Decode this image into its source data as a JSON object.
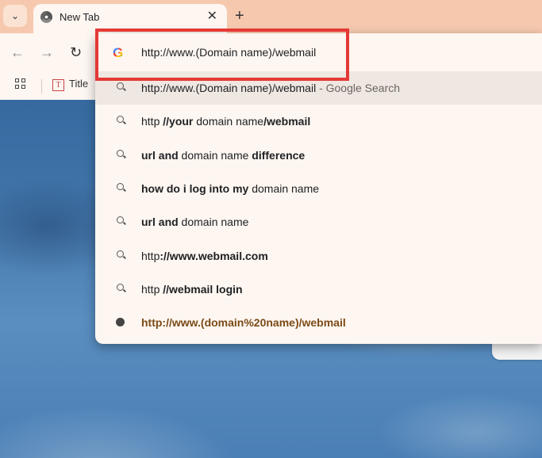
{
  "tabs": [
    {
      "title": "New Tab",
      "close_glyph": "✕"
    }
  ],
  "tab_search_glyph": "⌄",
  "new_tab_glyph": "+",
  "toolbar": {
    "back_glyph": "←",
    "forward_glyph": "→",
    "reload_glyph": "↻"
  },
  "bookmarks": {
    "items": [
      {
        "label": "Title",
        "favicon_letter": "T"
      }
    ]
  },
  "omnibox": {
    "value": "http://www.(Domain name)/webmail",
    "suggestions": [
      {
        "icon": "search-icon",
        "parts": [
          {
            "t": "http://www.(Domain name)/webmail"
          },
          {
            "t": " - Google Search",
            "gray": true
          }
        ]
      },
      {
        "icon": "search-icon",
        "parts": [
          {
            "t": "http "
          },
          {
            "t": "//your",
            "b": true
          },
          {
            "t": " domain name"
          },
          {
            "t": "/webmail",
            "b": true
          }
        ]
      },
      {
        "icon": "search-icon",
        "parts": [
          {
            "t": "url and",
            "b": true
          },
          {
            "t": " domain name "
          },
          {
            "t": "difference",
            "b": true
          }
        ]
      },
      {
        "icon": "search-icon",
        "parts": [
          {
            "t": "how do i log into my",
            "b": true
          },
          {
            "t": " domain name"
          }
        ]
      },
      {
        "icon": "search-icon",
        "parts": [
          {
            "t": "url and",
            "b": true
          },
          {
            "t": " domain name"
          }
        ]
      },
      {
        "icon": "search-icon",
        "parts": [
          {
            "t": "http"
          },
          {
            "t": "://www.webmail",
            "b": true
          },
          {
            "t": ".com",
            "b": true
          }
        ]
      },
      {
        "icon": "search-icon",
        "parts": [
          {
            "t": "http "
          },
          {
            "t": "//webmail",
            "b": true
          },
          {
            "t": " login",
            "b": true
          }
        ]
      },
      {
        "icon": "globe-icon",
        "parts": [
          {
            "t": "http://www.(domain%20name)/webmail",
            "url": true
          }
        ]
      }
    ]
  },
  "colors": {
    "tabstrip": "#f6c9ae",
    "chrome_surface": "#fdf6f1",
    "highlight_box": "#e53935"
  }
}
